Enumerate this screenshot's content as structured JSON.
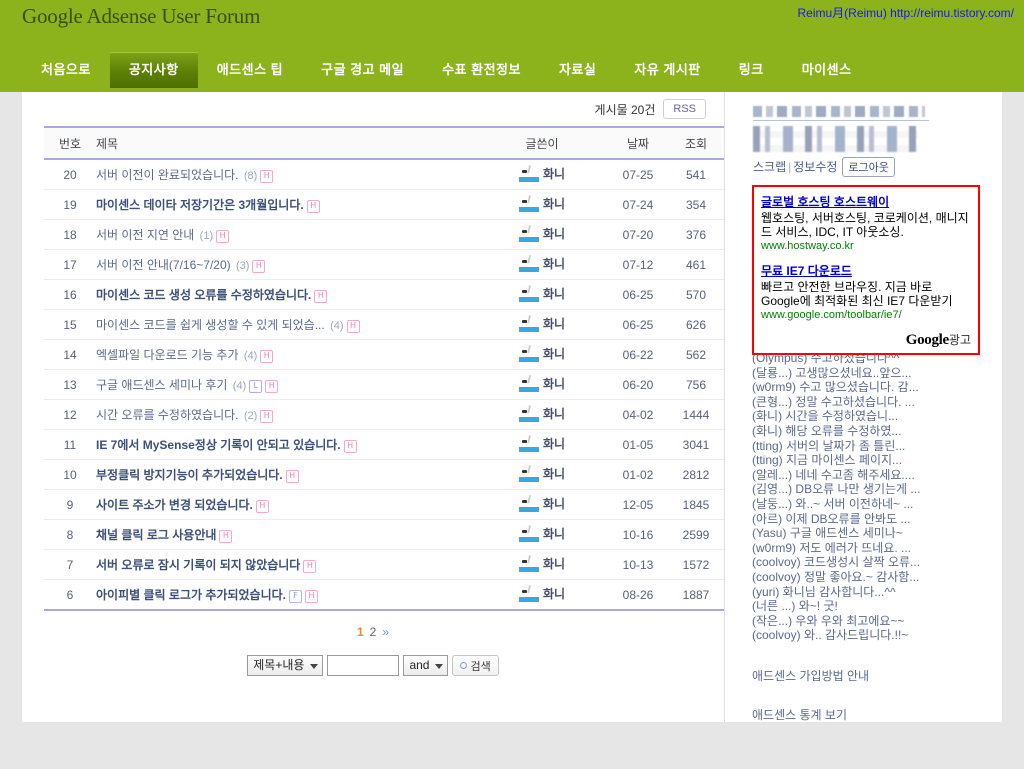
{
  "header": {
    "title": "Google Adsense User Forum",
    "owner_link": "Reimu月(Reimu) http://reimu.tistory.com/"
  },
  "nav": {
    "items": [
      {
        "label": "처음으로",
        "active": false
      },
      {
        "label": "공지사항",
        "active": true
      },
      {
        "label": "애드센스 팁",
        "active": false
      },
      {
        "label": "구글 경고 메일",
        "active": false
      },
      {
        "label": "수표 환전정보",
        "active": false
      },
      {
        "label": "자료실",
        "active": false
      },
      {
        "label": "자유 게시판",
        "active": false
      },
      {
        "label": "링크",
        "active": false
      },
      {
        "label": "마이센스",
        "active": false
      }
    ]
  },
  "board": {
    "count_label": "게시물 20건",
    "rss_label": "RSS",
    "columns": [
      "번호",
      "제목",
      "글쓴이",
      "날짜",
      "조회"
    ],
    "rows": [
      {
        "num": "20",
        "title": "서버 이전이 완료되었습니다.",
        "replies": "(8)",
        "badges": [
          "H"
        ],
        "bold": false,
        "user": "화니",
        "date": "07-25",
        "hits": "541"
      },
      {
        "num": "19",
        "title": "마이센스 데이타 저장기간은 3개월입니다.",
        "replies": "",
        "badges": [
          "H"
        ],
        "bold": true,
        "user": "화니",
        "date": "07-24",
        "hits": "354"
      },
      {
        "num": "18",
        "title": "서버 이전 지연 안내",
        "replies": "(1)",
        "badges": [
          "H"
        ],
        "bold": false,
        "user": "화니",
        "date": "07-20",
        "hits": "376"
      },
      {
        "num": "17",
        "title": "서버 이전 안내(7/16~7/20)",
        "replies": "(3)",
        "badges": [
          "H"
        ],
        "bold": false,
        "user": "화니",
        "date": "07-12",
        "hits": "461"
      },
      {
        "num": "16",
        "title": "마이센스 코드 생성 오류를 수정하였습니다.",
        "replies": "",
        "badges": [
          "H"
        ],
        "bold": true,
        "user": "화니",
        "date": "06-25",
        "hits": "570"
      },
      {
        "num": "15",
        "title": "마이센스 코드를 쉽게 생성할 수 있게 되었습...",
        "replies": "(4)",
        "badges": [
          "H"
        ],
        "bold": false,
        "user": "화니",
        "date": "06-25",
        "hits": "626"
      },
      {
        "num": "14",
        "title": "엑셀파일 다운로드 기능 추가",
        "replies": "(4)",
        "badges": [
          "H"
        ],
        "bold": false,
        "user": "화니",
        "date": "06-22",
        "hits": "562"
      },
      {
        "num": "13",
        "title": "구글 애드센스 세미나 후기",
        "replies": "(4)",
        "badges": [
          "L",
          "H"
        ],
        "bold": false,
        "user": "화니",
        "date": "06-20",
        "hits": "756"
      },
      {
        "num": "12",
        "title": "시간 오류를 수정하였습니다.",
        "replies": "(2)",
        "badges": [
          "H"
        ],
        "bold": false,
        "user": "화니",
        "date": "04-02",
        "hits": "1444"
      },
      {
        "num": "11",
        "title": "IE 7에서 MySense정상 기록이 안되고 있습니다.",
        "replies": "",
        "badges": [
          "H"
        ],
        "bold": true,
        "user": "화니",
        "date": "01-05",
        "hits": "3041"
      },
      {
        "num": "10",
        "title": "부정클릭 방지기능이 추가되었습니다.",
        "replies": "",
        "badges": [
          "H"
        ],
        "bold": true,
        "user": "화니",
        "date": "01-02",
        "hits": "2812"
      },
      {
        "num": "9",
        "title": "사이트 주소가 변경 되었습니다.",
        "replies": "",
        "badges": [
          "H"
        ],
        "bold": true,
        "user": "화니",
        "date": "12-05",
        "hits": "1845"
      },
      {
        "num": "8",
        "title": "채널 클릭 로그 사용안내",
        "replies": "",
        "badges": [
          "H"
        ],
        "bold": true,
        "user": "화니",
        "date": "10-16",
        "hits": "2599"
      },
      {
        "num": "7",
        "title": "서버 오류로 잠시 기록이 되지 않았습니다",
        "replies": "",
        "badges": [
          "H"
        ],
        "bold": true,
        "user": "화니",
        "date": "10-13",
        "hits": "1572"
      },
      {
        "num": "6",
        "title": "아이피별 클릭 로그가 추가되었습니다.",
        "replies": "",
        "badges": [
          "F",
          "H"
        ],
        "bold": true,
        "user": "화니",
        "date": "08-26",
        "hits": "1887"
      }
    ]
  },
  "paging": {
    "pages": [
      "1",
      "2"
    ],
    "current": "1",
    "next_label": "»"
  },
  "search": {
    "scope_selected": "제목+내용",
    "keyword_value": "",
    "keyword_placeholder": "",
    "operator_selected": "and",
    "button_label": "검색"
  },
  "sidebar": {
    "profile": {
      "scrap_label": "스크랩",
      "edit_label": "정보수정",
      "logout_label": "로그아웃"
    },
    "ads": [
      {
        "title": "글로벌 호스팅 호스트웨이",
        "desc": "웹호스팅, 서버호스팅, 코로케이션, 매니지드 서비스, IDC, IT 아웃소싱.",
        "url": "www.hostway.co.kr"
      },
      {
        "title": "무료 IE7 다운로드",
        "desc": "빠르고 안전한 브라우징. 지금 바로 Google에 최적화된 최신 IE7 다운받기",
        "url": "www.google.com/toolbar/ie7/"
      }
    ],
    "ad_brand": "Google",
    "ad_brand_suffix": "광고",
    "comments": [
      "(Olympus) 수고하셨습니다^^",
      "(달룡...) 고생많으셨네요..앞으...",
      "(w0rm9) 수고 많으셨습니다. 감...",
      "(큰형...) 정말 수고하셨습니다. ...",
      "(화니) 시간을 수정하였습니...",
      "(화니) 해당 오류를 수정하였...",
      "(tting) 서버의 날짜가 좀 틀린...",
      "(tting) 지금 마이센스 페이지...",
      "(알레...) 네네 수고좀 해주세요....",
      "(김영...) DB오류 나만 생기는게 ...",
      "(날둥...) 와..~ 서버 이전하네~ ...",
      "(아르) 이제 DB오류를 안봐도 ...",
      "(Yasu) 구글 애드센스 세미나~",
      "(w0rm9) 저도 에러가 뜨네요. ...",
      "(coolvoy) 코드생성시 살짝 오류...",
      "(coolvoy) 정말 좋아요.~ 감사함...",
      "(yuri) 화니님 감사합니다...^^",
      "(너른 ...) 와~! 굿!",
      "(작은...) 우와 우와 최고에요~~",
      "(coolvoy) 와.. 감사드립니다.!!~"
    ],
    "links": [
      "애드센스 가입방법 안내",
      "애드센스 통계 보기"
    ]
  },
  "colors": {
    "brand_green": "#8cb21c",
    "active_tab": "#5d8008",
    "ad_border": "#ff0000",
    "link_blue": "#1a1ae6",
    "page_current": "#ef8a1e"
  }
}
